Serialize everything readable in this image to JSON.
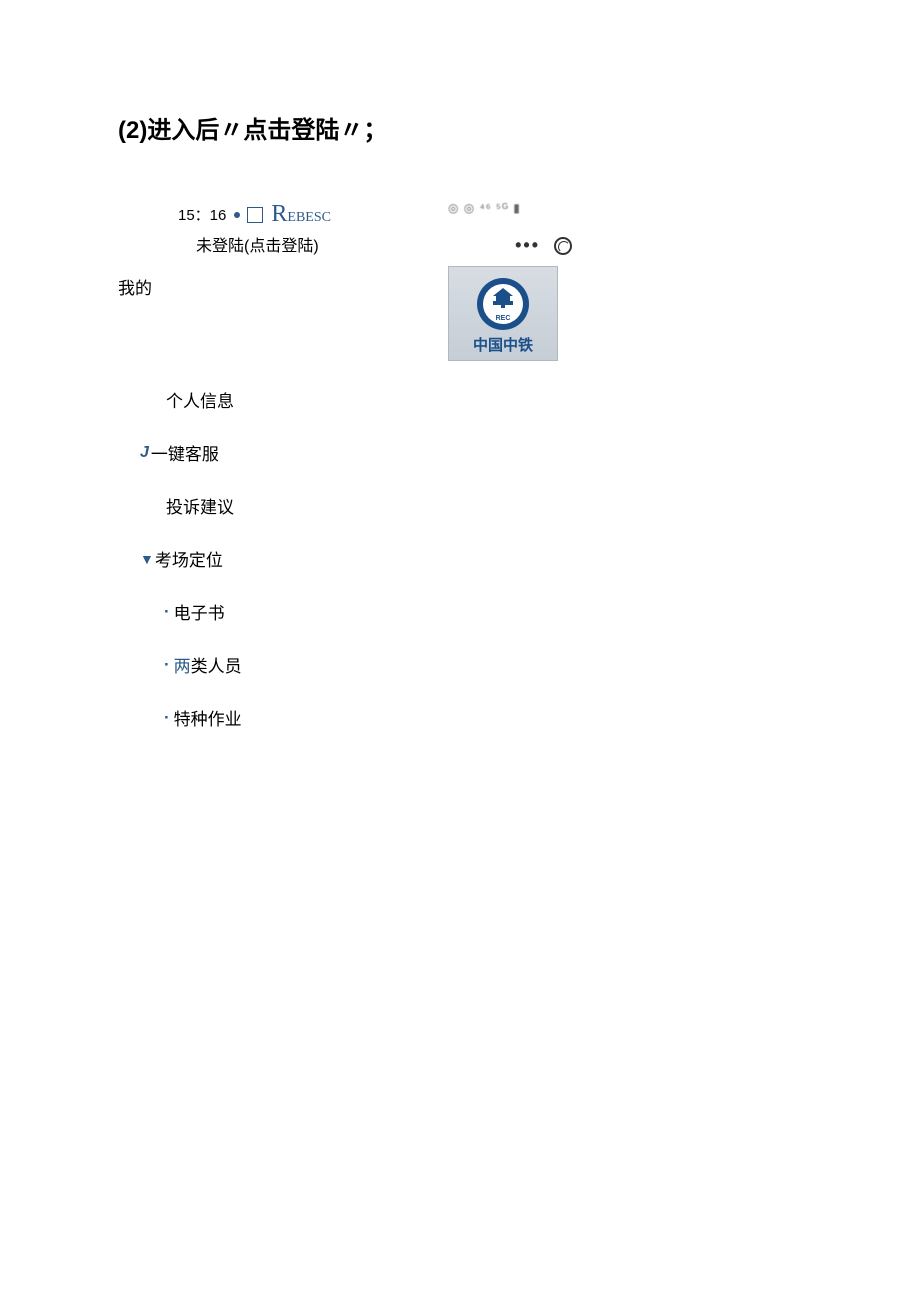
{
  "heading": "(2)进入后〃点击登陆〃；",
  "statusbar": {
    "time": "15：16",
    "app_label_big": "R",
    "app_label_small": "EBESC",
    "signal_text": "◎ ◎ ⁴⁶ ⁵ᴳ ▮"
  },
  "login_prompt": "未登陆(点击登陆)",
  "mine_label": "我的",
  "capsule": {
    "dots": "•••"
  },
  "logo": {
    "text": "中国中铁"
  },
  "menu": {
    "personal_info": "个人信息",
    "customer_service": "一键客服",
    "complaint": "投诉建议",
    "exam_location": "考场定位",
    "ebook": "电子书",
    "two_types_first": "两",
    "two_types_rest": "类人员",
    "special_work": "特种作业"
  }
}
